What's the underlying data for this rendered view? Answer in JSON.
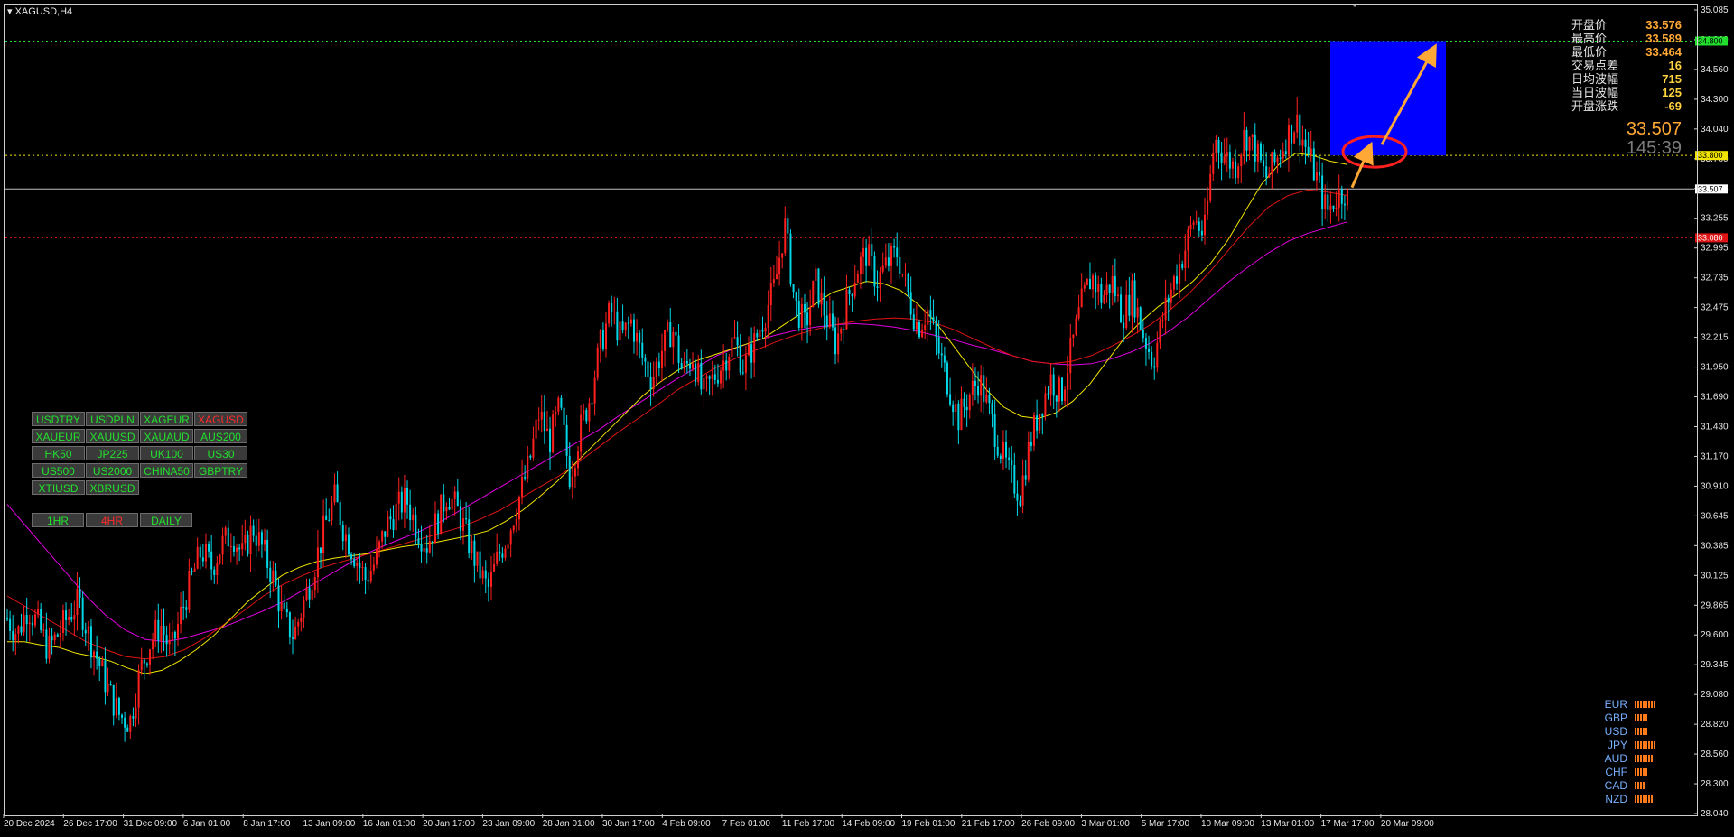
{
  "symbol_label": "XAGUSD,H4",
  "colors": {
    "bull": "#ff1f1f",
    "bear": "#00d8e8",
    "ma_fast": "#f2e600",
    "ma_mid": "#e01414",
    "ma_slow": "#e000e0",
    "target_box": "#0000ff",
    "arrow": "#ffa836",
    "circle": "#ff2020"
  },
  "info": [
    {
      "label": "开盘价",
      "value": "33.576",
      "tone": "orange"
    },
    {
      "label": "最高价",
      "value": "33.589",
      "tone": "orange"
    },
    {
      "label": "最低价",
      "value": "33.464",
      "tone": "orange"
    },
    {
      "label": "交易点差",
      "value": "16",
      "tone": "yellow"
    },
    {
      "label": "日均波幅",
      "value": "715",
      "tone": "yellow"
    },
    {
      "label": "当日波幅",
      "value": "125",
      "tone": "yellow"
    },
    {
      "label": "开盘涨跌",
      "value": "-69",
      "tone": "yellow"
    }
  ],
  "current_price": "33.507",
  "countdown": "145:39",
  "symbols": [
    {
      "label": "USDTRY",
      "active": false
    },
    {
      "label": "USDPLN",
      "active": false
    },
    {
      "label": "XAGEUR",
      "active": false
    },
    {
      "label": "XAGUSD",
      "active": true
    },
    {
      "label": "XAUEUR",
      "active": false
    },
    {
      "label": "XAUUSD",
      "active": false
    },
    {
      "label": "XAUAUD",
      "active": false
    },
    {
      "label": "AUS200",
      "active": false
    },
    {
      "label": "HK50",
      "active": false
    },
    {
      "label": "JP225",
      "active": false
    },
    {
      "label": "UK100",
      "active": false
    },
    {
      "label": "US30",
      "active": false
    },
    {
      "label": "US500",
      "active": false
    },
    {
      "label": "US2000",
      "active": false
    },
    {
      "label": "CHINA50",
      "active": false
    },
    {
      "label": "GBPTRY",
      "active": false
    },
    {
      "label": "XTIUSD",
      "active": false
    },
    {
      "label": "XBRUSD",
      "active": false
    }
  ],
  "timeframes": [
    {
      "label": "1HR",
      "active": false
    },
    {
      "label": "4HR",
      "active": true
    },
    {
      "label": "DAILY",
      "active": false
    }
  ],
  "currency_strength": [
    {
      "name": "EUR",
      "bars": 8
    },
    {
      "name": "GBP",
      "bars": 5
    },
    {
      "name": "USD",
      "bars": 5
    },
    {
      "name": "JPY",
      "bars": 8
    },
    {
      "name": "AUD",
      "bars": 7
    },
    {
      "name": "CHF",
      "bars": 5
    },
    {
      "name": "CAD",
      "bars": 4
    },
    {
      "name": "NZD",
      "bars": 7
    }
  ],
  "chart_data": {
    "type": "candlestick",
    "ylim": [
      28.04,
      35.08
    ],
    "y_ticks": [
      "35.085",
      "34.820",
      "34.560",
      "34.300",
      "34.040",
      "33.780",
      "33.515",
      "33.255",
      "32.995",
      "32.735",
      "32.475",
      "32.215",
      "31.950",
      "31.690",
      "31.430",
      "31.170",
      "30.910",
      "30.645",
      "30.385",
      "30.125",
      "29.865",
      "29.600",
      "29.345",
      "29.080",
      "28.820",
      "28.560",
      "28.300",
      "28.040"
    ],
    "x_ticks": [
      "20 Dec 2024",
      "26 Dec 17:00",
      "31 Dec 09:00",
      "6 Jan 01:00",
      "8 Jan 17:00",
      "13 Jan 09:00",
      "16 Jan 01:00",
      "20 Jan 17:00",
      "23 Jan 09:00",
      "28 Jan 01:00",
      "30 Jan 17:00",
      "4 Feb 09:00",
      "7 Feb 01:00",
      "11 Feb 17:00",
      "14 Feb 09:00",
      "19 Feb 01:00",
      "21 Feb 17:00",
      "26 Feb 09:00",
      "3 Mar 01:00",
      "5 Mar 17:00",
      "10 Mar 09:00",
      "13 Mar 01:00",
      "17 Mar 17:00",
      "20 Mar 09:00"
    ],
    "h_lines": [
      {
        "price": 34.8,
        "label": "34.800",
        "color": "#22e02e"
      },
      {
        "price": 33.8,
        "label": "33.800",
        "color": "#f2e600"
      },
      {
        "price": 33.507,
        "label": "33.507",
        "color": "#c0c0c0"
      },
      {
        "price": 33.08,
        "label": "33.080",
        "color": "#e01414"
      }
    ],
    "close_path": [
      29.75,
      29.62,
      29.85,
      29.7,
      29.48,
      29.62,
      29.78,
      29.9,
      29.6,
      29.35,
      29.1,
      28.9,
      28.85,
      29.3,
      29.55,
      29.7,
      29.45,
      29.8,
      30.1,
      30.35,
      30.2,
      30.4,
      30.5,
      30.3,
      30.55,
      30.35,
      30.1,
      29.75,
      29.6,
      29.9,
      30.2,
      30.55,
      30.8,
      30.5,
      30.3,
      30.1,
      30.25,
      30.55,
      30.7,
      30.8,
      30.55,
      30.4,
      30.6,
      30.85,
      30.7,
      30.45,
      30.2,
      30.0,
      30.3,
      30.5,
      30.8,
      31.1,
      31.55,
      31.3,
      31.6,
      31.0,
      31.4,
      31.7,
      32.15,
      32.45,
      32.2,
      32.35,
      32.05,
      31.85,
      32.1,
      32.3,
      31.9,
      32.05,
      31.7,
      31.85,
      32.0,
      32.2,
      31.95,
      32.15,
      32.4,
      32.65,
      33.2,
      32.5,
      32.3,
      32.7,
      32.4,
      32.15,
      32.5,
      32.8,
      32.95,
      32.7,
      32.85,
      32.95,
      32.6,
      32.3,
      32.45,
      32.1,
      31.8,
      31.5,
      31.7,
      31.85,
      31.55,
      31.25,
      31.0,
      30.85,
      31.3,
      31.6,
      31.85,
      31.7,
      32.1,
      32.5,
      32.75,
      32.55,
      32.7,
      32.4,
      32.6,
      32.25,
      32.0,
      32.4,
      32.7,
      32.95,
      33.25,
      33.1,
      33.95,
      33.8,
      33.7,
      34.0,
      33.85,
      33.6,
      33.75,
      33.95,
      34.1,
      33.85,
      33.6,
      33.3,
      33.45,
      33.507
    ],
    "ma_fast": [
      29.55,
      29.55,
      29.52,
      29.5,
      29.45,
      29.42,
      29.38,
      29.32,
      29.27,
      29.3,
      29.38,
      29.48,
      29.6,
      29.75,
      29.9,
      30.02,
      30.13,
      30.2,
      30.25,
      30.28,
      30.3,
      30.32,
      30.35,
      30.38,
      30.4,
      30.42,
      30.45,
      30.48,
      30.52,
      30.6,
      30.7,
      30.82,
      30.95,
      31.1,
      31.25,
      31.4,
      31.55,
      31.7,
      31.82,
      31.92,
      32.0,
      32.05,
      32.1,
      32.15,
      32.2,
      32.3,
      32.4,
      32.5,
      32.6,
      32.65,
      32.7,
      32.68,
      32.62,
      32.5,
      32.35,
      32.15,
      31.95,
      31.75,
      31.6,
      31.52,
      31.5,
      31.55,
      31.65,
      31.8,
      32.0,
      32.2,
      32.35,
      32.48,
      32.58,
      32.7,
      32.85,
      33.05,
      33.3,
      33.55,
      33.72,
      33.82,
      33.8,
      33.75,
      33.72
    ],
    "ma_mid": [
      29.95,
      29.85,
      29.75,
      29.65,
      29.55,
      29.48,
      29.42,
      29.4,
      29.42,
      29.48,
      29.58,
      29.7,
      29.82,
      29.95,
      30.05,
      30.13,
      30.2,
      30.25,
      30.3,
      30.35,
      30.4,
      30.45,
      30.5,
      30.55,
      30.62,
      30.7,
      30.8,
      30.9,
      31.0,
      31.12,
      31.25,
      31.38,
      31.5,
      31.62,
      31.75,
      31.85,
      31.95,
      32.03,
      32.1,
      32.17,
      32.23,
      32.28,
      32.32,
      32.35,
      32.37,
      32.38,
      32.37,
      32.34,
      32.28,
      32.2,
      32.12,
      32.05,
      32.0,
      31.98,
      32.0,
      32.05,
      32.13,
      32.22,
      32.32,
      32.45,
      32.6,
      32.78,
      32.98,
      33.18,
      33.35,
      33.45,
      33.5,
      33.48,
      33.45
    ],
    "ma_slow": [
      30.75,
      30.55,
      30.35,
      30.15,
      29.95,
      29.78,
      29.65,
      29.57,
      29.55,
      29.58,
      29.63,
      29.68,
      29.75,
      29.82,
      29.9,
      30.0,
      30.1,
      30.2,
      30.3,
      30.38,
      30.45,
      30.52,
      30.6,
      30.7,
      30.8,
      30.9,
      31.0,
      31.1,
      31.2,
      31.3,
      31.4,
      31.52,
      31.63,
      31.74,
      31.85,
      31.95,
      32.05,
      32.12,
      32.18,
      32.23,
      32.27,
      32.3,
      32.32,
      32.33,
      32.32,
      32.3,
      32.27,
      32.23,
      32.19,
      32.14,
      32.1,
      32.05,
      32.0,
      31.98,
      31.97,
      31.98,
      32.02,
      32.08,
      32.16,
      32.27,
      32.4,
      32.55,
      32.7,
      32.83,
      32.95,
      33.05,
      33.12,
      33.17,
      33.22
    ]
  }
}
